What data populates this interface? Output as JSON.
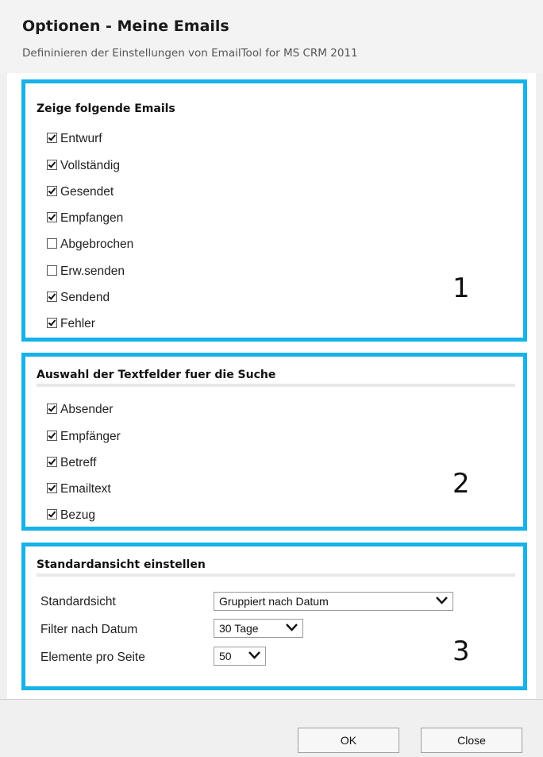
{
  "header": {
    "title": "Optionen - Meine Emails",
    "subtitle": "Defininieren der Einstellungen von EmailTool for MS CRM 2011"
  },
  "section1": {
    "title": "Zeige folgende Emails",
    "number": "1",
    "items": [
      {
        "label": "Entwurf",
        "checked": true
      },
      {
        "label": "Vollständig",
        "checked": true
      },
      {
        "label": "Gesendet",
        "checked": true
      },
      {
        "label": "Empfangen",
        "checked": true
      },
      {
        "label": "Abgebrochen",
        "checked": false
      },
      {
        "label": "Erw.senden",
        "checked": false
      },
      {
        "label": "Sendend",
        "checked": true
      },
      {
        "label": "Fehler",
        "checked": true
      }
    ]
  },
  "section2": {
    "title": "Auswahl der Textfelder fuer die Suche",
    "number": "2",
    "items": [
      {
        "label": "Absender",
        "checked": true
      },
      {
        "label": "Empfänger",
        "checked": true
      },
      {
        "label": "Betreff",
        "checked": true
      },
      {
        "label": "Emailtext",
        "checked": true
      },
      {
        "label": "Bezug",
        "checked": true
      }
    ]
  },
  "section3": {
    "title": "Standardansicht einstellen",
    "number": "3",
    "rows": [
      {
        "label": "Standardsicht",
        "value": "Gruppiert nach Datum"
      },
      {
        "label": "Filter nach Datum",
        "value": "30 Tage"
      },
      {
        "label": "Elemente pro Seite",
        "value": "50"
      }
    ]
  },
  "footer": {
    "ok_label": "OK",
    "close_label": "Close"
  },
  "colors": {
    "section_border": "#16b2e8"
  }
}
